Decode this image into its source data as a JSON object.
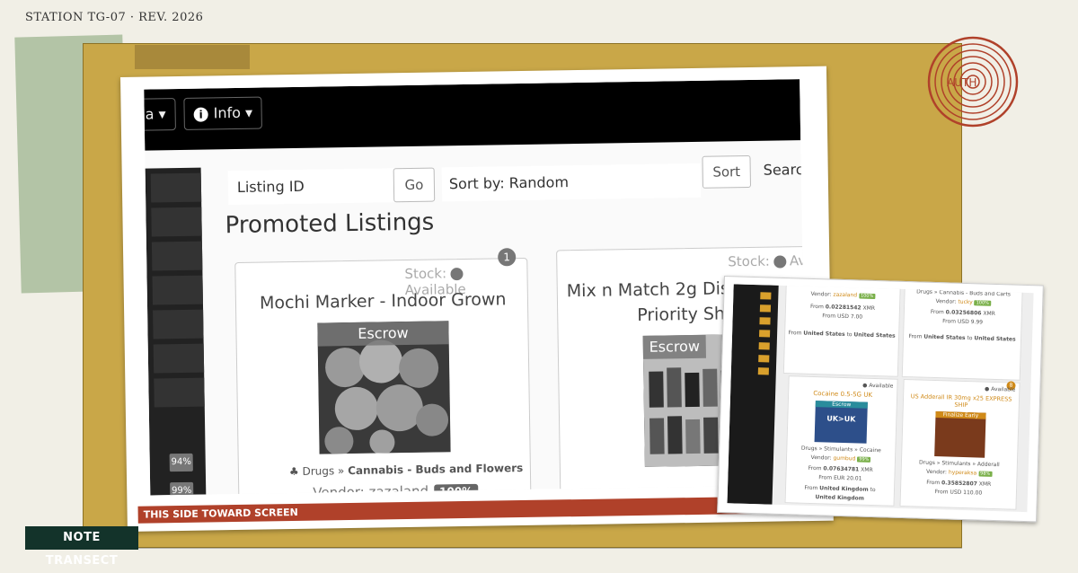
{
  "page": {
    "header_text": "STATION TG-07  ·  REV. 2026",
    "note_label": "NOTE TRANSECT",
    "strip_label": "THIS SIDE TOWARD SCREEN",
    "seal_text": "AUTH"
  },
  "colors": {
    "board": "#c9a748",
    "green_paper": "#b3c4a6",
    "note_label_bg": "#13332a",
    "strip_bg": "#b0412a",
    "seal": "#b0412a",
    "accent_orange": "#d08a18",
    "vendor_pill_green": "#7ab04a"
  },
  "main_screenshot": {
    "navbar": {
      "menu_fragment": "a",
      "info_button": "Info",
      "info_icon": "info-icon"
    },
    "search": {
      "listing_id_placeholder": "Listing ID",
      "go_button": "Go",
      "sort_label": "Sort by: Random",
      "sort_button": "Sort",
      "search_fragment": "Searc"
    },
    "section_title": "Promoted Listings",
    "sidebar_percents": [
      "94%",
      "99%"
    ],
    "listings": [
      {
        "badge": "1",
        "stock_label": "Stock:",
        "stock_status": "Available",
        "title": "Mochi Marker - Indoor Grown",
        "escrow": "Escrow",
        "category_prefix": "Drugs",
        "category_path": "Cannabis - Buds and Flowers",
        "vendor_label": "Vendor:",
        "vendor_name": "zazaland",
        "vendor_score": "100%"
      },
      {
        "stock_label": "Stock:",
        "stock_status": "Ava",
        "title_line1": "Mix n Match 2g Disposable -",
        "title_line2": "Priority Shi",
        "escrow": "Escrow"
      }
    ]
  },
  "inset_screenshot": {
    "sidebar_percents": [
      "94%",
      "99%",
      "97%",
      "93%",
      "99%",
      "95%",
      "98%"
    ],
    "top_cards": [
      {
        "vendor_label": "Vendor:",
        "vendor": "zazaland",
        "score": "100%",
        "price_xmr": "0.02281542",
        "currency": "XMR",
        "price_fiat": "USD 7.00",
        "from": "United States",
        "to": "United States"
      },
      {
        "category": "Drugs » Cannabis - Buds and Carts",
        "vendor_label": "Vendor:",
        "vendor": "tucky",
        "score": "100%",
        "price_xmr": "0.03256806",
        "currency": "XMR",
        "price_fiat": "USD 9.99",
        "from": "United States",
        "to": "United States"
      }
    ],
    "bottom_cards": [
      {
        "stock": "Available",
        "title": "Cocaine 0.5-5G UK",
        "escrow": "Escrow",
        "image_text": "UK>UK",
        "category": "Drugs » Stimulants » Cocaine",
        "vendor_label": "Vendor:",
        "vendor": "gumbud",
        "score": "99%",
        "price_xmr": "0.07634781",
        "currency": "XMR",
        "price_fiat": "EUR 20.01",
        "from": "United Kingdom",
        "to": "United Kingdom"
      },
      {
        "badge": "8",
        "stock": "Available",
        "title": "US Adderall IR 30mg x25 EXPRESS SHIP",
        "image_text": "Finalize Early",
        "category": "Drugs » Stimulants » Adderall",
        "vendor_label": "Vendor:",
        "vendor": "hyperaksa",
        "score": "98%",
        "price_xmr": "0.35852807",
        "currency": "XMR",
        "price_fiat": "USD 110.00"
      }
    ]
  }
}
